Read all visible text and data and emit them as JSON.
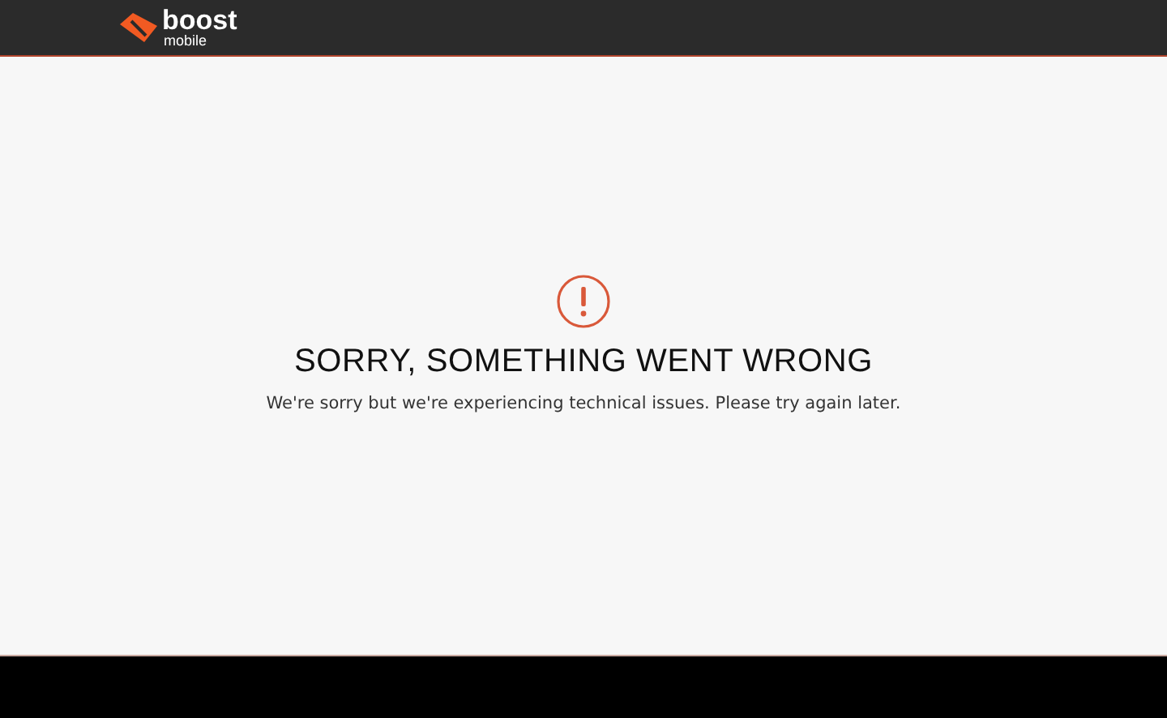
{
  "header": {
    "logo": {
      "name": "boost",
      "tagline": "mobile"
    }
  },
  "error": {
    "title": "SORRY, SOMETHING WENT WRONG",
    "message": "We're sorry but we're experiencing technical issues. Please try again later."
  }
}
